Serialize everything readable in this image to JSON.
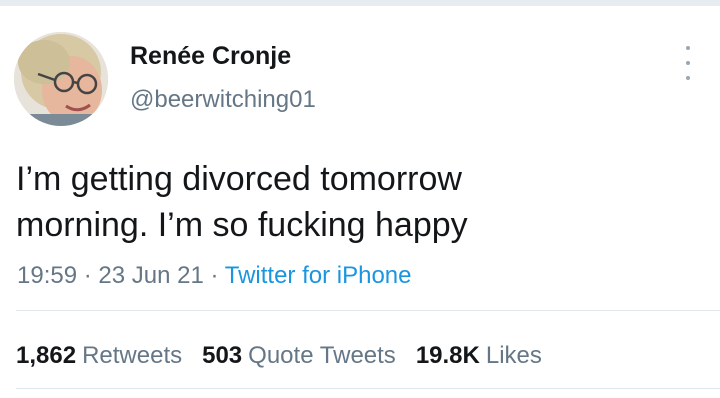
{
  "user": {
    "display_name": "Renée Cronje",
    "handle": "@beerwitching01"
  },
  "tweet": {
    "lines": [
      "I’m getting divorced tomorrow",
      "morning. I’m so fucking happy"
    ],
    "time": "19:59",
    "date": "23 Jun 21",
    "separator": "·",
    "source": "Twitter for iPhone"
  },
  "stats": {
    "retweets_count": "1,862",
    "retweets_label": "Retweets",
    "quotes_count": "503",
    "quotes_label": "Quote Tweets",
    "likes_count": "19.8K",
    "likes_label": "Likes"
  },
  "icons": {
    "more": "more-options-icon",
    "avatar": "avatar"
  },
  "colors": {
    "text_primary": "#14171a",
    "text_secondary": "#657786",
    "link": "#1b95e0",
    "divider": "#e1e8ed"
  }
}
